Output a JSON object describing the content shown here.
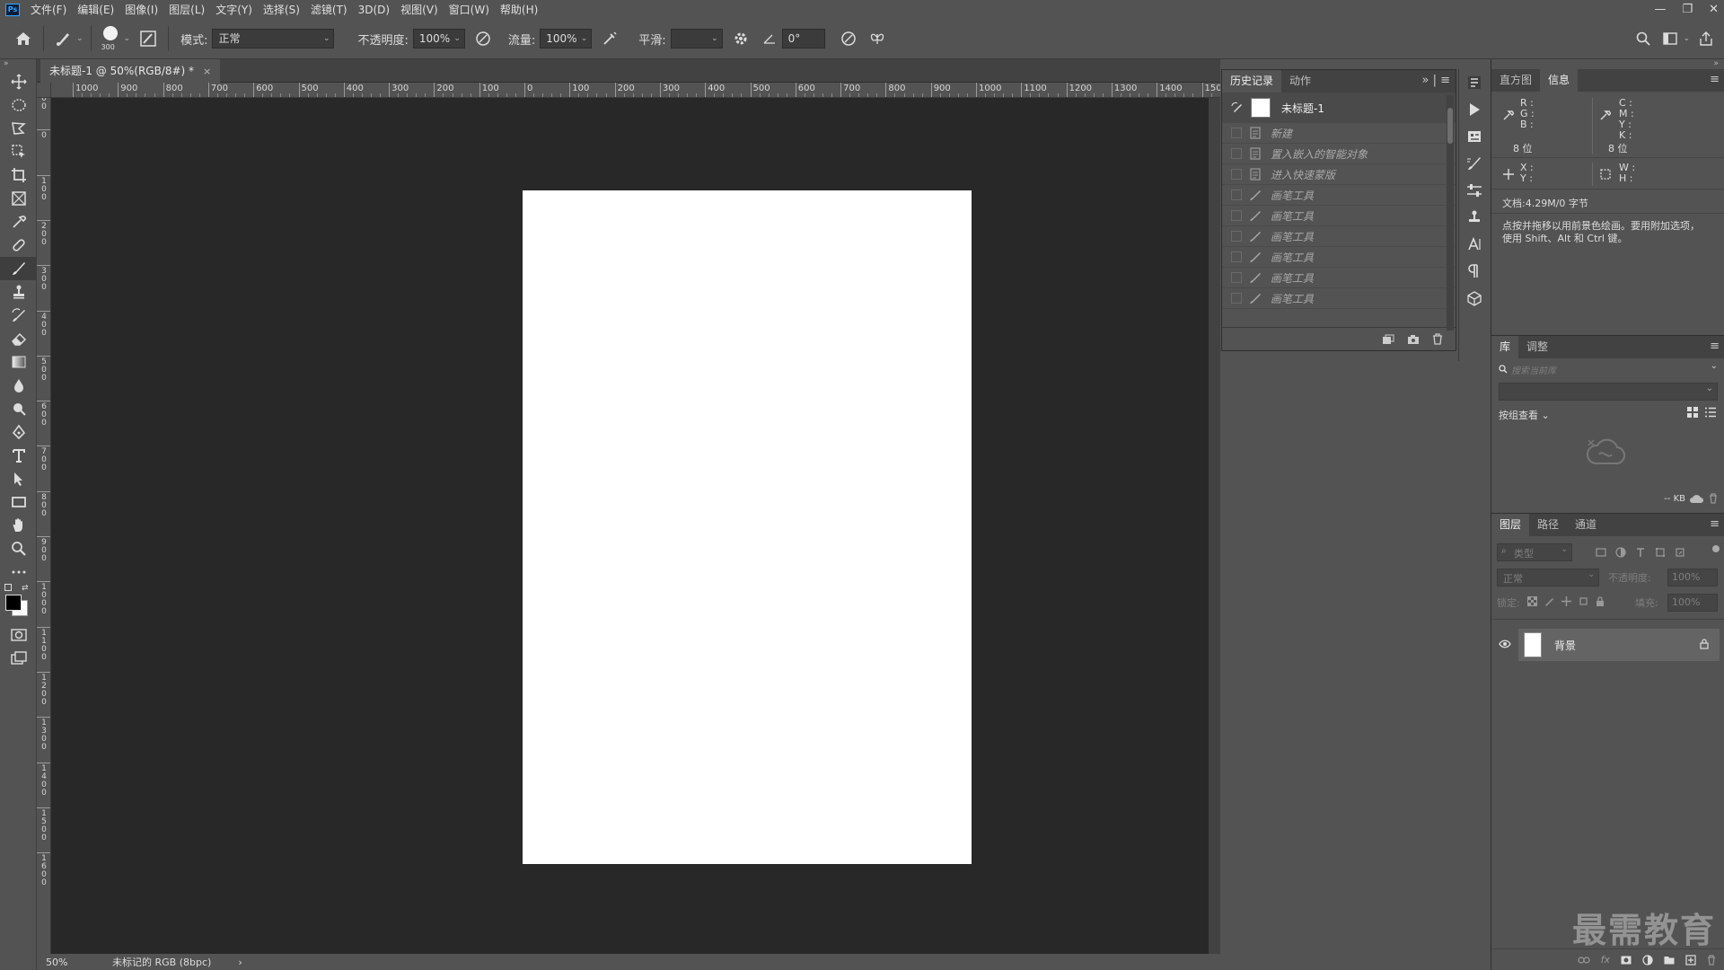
{
  "app": {
    "logo": "Ps"
  },
  "menubar": {
    "items": [
      "文件(F)",
      "编辑(E)",
      "图像(I)",
      "图层(L)",
      "文字(Y)",
      "选择(S)",
      "滤镜(T)",
      "3D(D)",
      "视图(V)",
      "窗口(W)",
      "帮助(H)"
    ]
  },
  "window_controls": {
    "minimize": "—",
    "restore": "❐",
    "close": "✕"
  },
  "options_bar": {
    "brush_size": "300",
    "mode_label": "模式:",
    "mode_value": "正常",
    "opacity_label": "不透明度:",
    "opacity_value": "100%",
    "flow_label": "流量:",
    "flow_value": "100%",
    "smoothing_label": "平滑:",
    "smoothing_value": "",
    "angle_value": "0°"
  },
  "document": {
    "tab_title": "未标题-1 @ 50%(RGB/8#) *",
    "tab_close": "×",
    "canvas_color": "#ffffff"
  },
  "rulers": {
    "horizontal": [
      "1000",
      "900",
      "800",
      "700",
      "600",
      "500",
      "400",
      "300",
      "200",
      "100",
      "0",
      "100",
      "200",
      "300",
      "400",
      "500",
      "600",
      "700",
      "800",
      "900",
      "1000",
      "1100",
      "1200",
      "1300",
      "1400",
      "1500"
    ],
    "vertical": [
      "2 0 0",
      "0",
      "1 0 0",
      "2 0 0",
      "3 0 0",
      "4 0 0",
      "5 0 0",
      "6 0 0",
      "7 0 0",
      "8 0 0",
      "9 0 0",
      "1 0 0 0",
      "1 1 0 0",
      "1 2 0 0",
      "1 3 0 0",
      "1 4 0 0",
      "1 5 0 0",
      "1 6 0 0"
    ]
  },
  "status_bar": {
    "zoom": "50%",
    "doc_profile": "未标记的 RGB (8bpc)",
    "arrow": "›"
  },
  "history_panel": {
    "tabs": [
      "历史记录",
      "动作"
    ],
    "active_tab": 0,
    "expand": "»",
    "snapshot_name": "未标题-1",
    "states": [
      {
        "label": "新建",
        "icon": "document-icon"
      },
      {
        "label": "置入嵌入的智能对象",
        "icon": "document-icon"
      },
      {
        "label": "进入快速蒙版",
        "icon": "document-icon"
      },
      {
        "label": "画笔工具",
        "icon": "brush-icon"
      },
      {
        "label": "画笔工具",
        "icon": "brush-icon"
      },
      {
        "label": "画笔工具",
        "icon": "brush-icon"
      },
      {
        "label": "画笔工具",
        "icon": "brush-icon"
      },
      {
        "label": "画笔工具",
        "icon": "brush-icon"
      },
      {
        "label": "画笔工具",
        "icon": "brush-icon"
      }
    ]
  },
  "info_panel": {
    "tabs": [
      "直方图",
      "信息"
    ],
    "active_tab": 1,
    "rgb_labels": [
      "R :",
      "G :",
      "B :"
    ],
    "cmyk_labels": [
      "C :",
      "M :",
      "Y :",
      "K :"
    ],
    "bit_left": "8 位",
    "bit_right": "8 位",
    "xy_labels": [
      "X :",
      "Y :"
    ],
    "wh_labels": [
      "W :",
      "H :"
    ],
    "doc_size": "文档:4.29M/0 字节",
    "hint": "点按并拖移以用前景色绘画。要用附加选项，使用 Shift、Alt 和 Ctrl 键。"
  },
  "library_panel": {
    "tabs": [
      "库",
      "调整"
    ],
    "active_tab": 0,
    "search_placeholder": "搜索当前库",
    "view_by": "按组查看",
    "size": "-- KB"
  },
  "layers_panel": {
    "tabs": [
      "图层",
      "路径",
      "通道"
    ],
    "active_tab": 0,
    "filter_label": "类型",
    "blend_mode": "正常",
    "opacity_label": "不透明度:",
    "opacity_value": "100%",
    "lock_label": "锁定:",
    "fill_label": "填充:",
    "fill_value": "100%",
    "layers": [
      {
        "name": "背景",
        "visible": true,
        "locked": true
      }
    ]
  },
  "watermark": "最需教育",
  "colors": {
    "ui_bg": "#535353",
    "canvas_bg": "#282828",
    "panel_dark": "#424242",
    "foreground": "#000000",
    "background": "#ffffff"
  }
}
